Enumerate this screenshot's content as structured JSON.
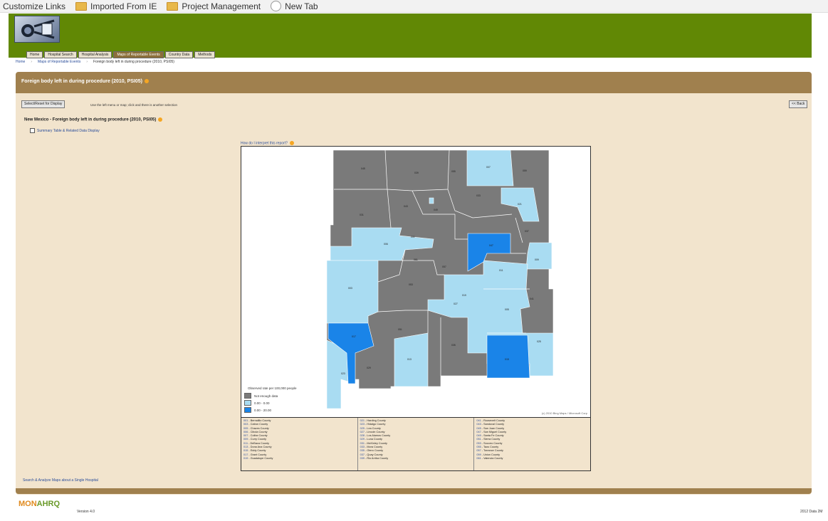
{
  "bookmarks": [
    {
      "label": "Customize Links",
      "icon": "none"
    },
    {
      "label": "Imported From IE",
      "icon": "folder-icon"
    },
    {
      "label": "Project Management",
      "icon": "folder-icon"
    },
    {
      "label": "New Tab",
      "icon": "new-tab-icon"
    }
  ],
  "nav": {
    "tabs": [
      "Home",
      "Hospital Search",
      "Hospital Analysis",
      "Maps of Reportable Events",
      "Country Data",
      "Methods"
    ],
    "active_index": 3
  },
  "breadcrumb": [
    "Home",
    "Maps of Reportable Events",
    "Foreign body left in during procedure (2010, PSI05)"
  ],
  "page": {
    "title": "Foreign body left in during procedure (2010, PSI05)",
    "select_button": "Select/Reset for Display",
    "instructions": "Use the left menu or map; click and there is another selection",
    "back_button": "<< Back",
    "subtitle": "New Mexico - Foreign body left in during procedure (2010, PSI05)",
    "checkbox_label": "Summary Table & Related Data Display",
    "map_link": "How do I interpret this report?"
  },
  "map": {
    "legend_title": "Observed rate per 100,000 people",
    "legend": [
      {
        "label": "Not enough data",
        "color": "#7a7a7a"
      },
      {
        "label": "0.00 - 0.00",
        "color": "#a9dcf2"
      },
      {
        "label": "0.00 - 20.00",
        "color": "#1a84e8"
      }
    ],
    "credit": "(c) 2010 Bing Maps / Microsoft Corp",
    "colors": {
      "gray": "#7a7a7a",
      "light": "#a9dcf2",
      "blue": "#1a84e8"
    }
  },
  "county_table": [
    [
      {
        "code": "001",
        "name": "Bernalillo County"
      },
      {
        "code": "003",
        "name": "Catron County"
      },
      {
        "code": "005",
        "name": "Chaves County"
      },
      {
        "code": "006",
        "name": "Cibola County"
      },
      {
        "code": "007",
        "name": "Colfax County"
      },
      {
        "code": "009",
        "name": "Curry County"
      },
      {
        "code": "011",
        "name": "DeBaca County"
      },
      {
        "code": "013",
        "name": "Dona Ana County"
      },
      {
        "code": "015",
        "name": "Eddy County"
      },
      {
        "code": "017",
        "name": "Grant County"
      },
      {
        "code": "019",
        "name": "Guadalupe County"
      }
    ],
    [
      {
        "code": "021",
        "name": "Harding County"
      },
      {
        "code": "023",
        "name": "Hidalgo County"
      },
      {
        "code": "025",
        "name": "Lea County"
      },
      {
        "code": "027",
        "name": "Lincoln County"
      },
      {
        "code": "028",
        "name": "Los Alamos County"
      },
      {
        "code": "029",
        "name": "Luna County"
      },
      {
        "code": "031",
        "name": "McKinley County"
      },
      {
        "code": "033",
        "name": "Mora County"
      },
      {
        "code": "035",
        "name": "Otero County"
      },
      {
        "code": "037",
        "name": "Quay County"
      },
      {
        "code": "039",
        "name": "Rio Arriba County"
      }
    ],
    [
      {
        "code": "041",
        "name": "Roosevelt County"
      },
      {
        "code": "043",
        "name": "Sandoval County"
      },
      {
        "code": "045",
        "name": "San Juan County"
      },
      {
        "code": "047",
        "name": "San Miguel County"
      },
      {
        "code": "049",
        "name": "Santa Fe County"
      },
      {
        "code": "051",
        "name": "Sierra County"
      },
      {
        "code": "053",
        "name": "Socorro County"
      },
      {
        "code": "055",
        "name": "Taos County"
      },
      {
        "code": "057",
        "name": "Torrance County"
      },
      {
        "code": "059",
        "name": "Union County"
      },
      {
        "code": "061",
        "name": "Valencia County"
      }
    ]
  ],
  "bottom_link": "Search & Analyze Maps about a Single Hospital",
  "footer": {
    "logo_left": "MON",
    "logo_right": "AHRQ",
    "version": "Version 4.0",
    "copyright": "2012 Data 2M"
  }
}
